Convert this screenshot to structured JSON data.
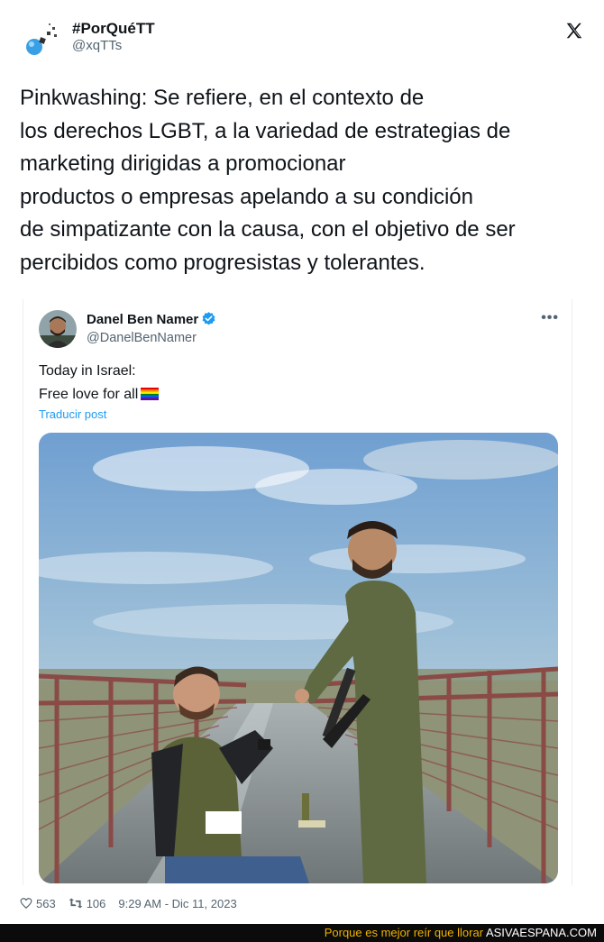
{
  "tweet": {
    "account_name": "#PorQuéTT",
    "handle": "@xqTTs",
    "text_lines": [
      "Pinkwashing: Se refiere, en el contexto de",
      "los derechos LGBT, a la variedad de estrategias de",
      "marketing dirigidas a promocionar",
      "productos o empresas apelando a su condición",
      "de simpatizante con la causa, con el objetivo de ser",
      "percibidos como progresistas y tolerantes."
    ]
  },
  "quoted_tweet": {
    "name": "Danel Ben Namer",
    "handle": "@DanelBenNamer",
    "more_label": "•••",
    "text_line1": "Today in Israel:",
    "text_line2": "Free love for all",
    "translate_label": "Traducir post",
    "emoji": "rainbow-flag-icon"
  },
  "stats": {
    "likes": "563",
    "retweets": "106",
    "timestamp": "9:29 AM - Dic 11, 2023"
  },
  "footer": {
    "tagline": "Porque es mejor reír que llorar",
    "site": "ASIVAESPANA.COM"
  },
  "colors": {
    "link_blue": "#1d9bf0",
    "verified_blue": "#1d9bf0",
    "footer_yellow": "#f0b300",
    "secondary_text": "#536471"
  }
}
